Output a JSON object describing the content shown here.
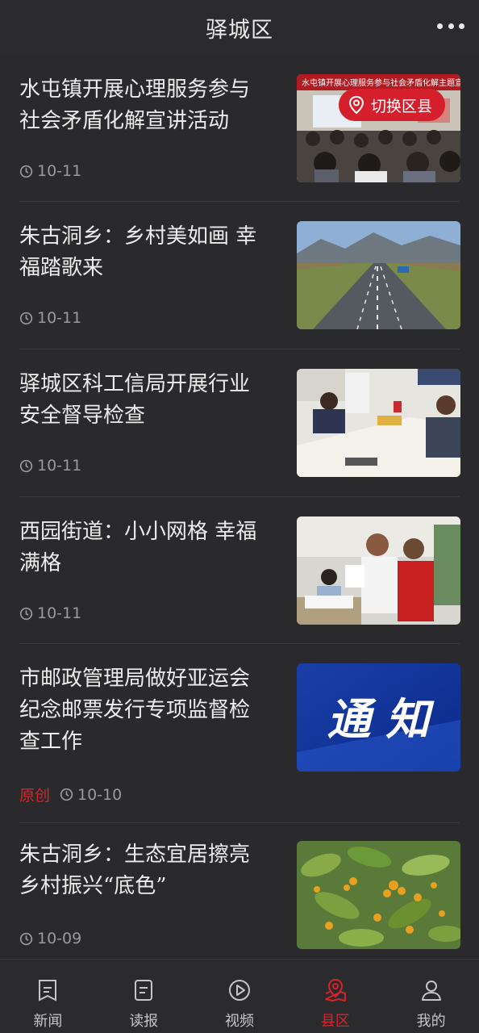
{
  "header": {
    "title": "驿城区",
    "more_icon": "more-dots-icon"
  },
  "switch_button": {
    "label": "切换区县",
    "icon": "location-pin-icon"
  },
  "articles": [
    {
      "title_lines": [
        "水屯镇开展心理服务参与",
        "社会矛盾化解宣讲活动"
      ],
      "original": "",
      "date": "10-11",
      "thumb": "meeting-hall-photo",
      "thumb_caption": "水屯镇开展心理服务参与社会矛盾化解主题宣讲"
    },
    {
      "title_lines": [
        "朱古洞乡：乡村美如画 幸",
        "福踏歌来"
      ],
      "original": "",
      "date": "10-11",
      "thumb": "road-mountains-photo"
    },
    {
      "title_lines": [
        "驿城区科工信局开展行业",
        "安全督导检查"
      ],
      "original": "",
      "date": "10-11",
      "thumb": "office-inspection-photo"
    },
    {
      "title_lines": [
        "西园街道：小小网格 幸福",
        "满格"
      ],
      "original": "",
      "date": "10-11",
      "thumb": "grid-workers-photo"
    },
    {
      "title_lines": [
        "市邮政管理局做好亚运会",
        "纪念邮票发行专项监督检",
        "查工作"
      ],
      "original": "原创",
      "date": "10-10",
      "thumb": "notice-banner",
      "thumb_text": "通 知"
    },
    {
      "title_lines": [
        "朱古洞乡：生态宜居擦亮",
        "乡村振兴“底色”"
      ],
      "original": "",
      "date": "10-09",
      "thumb": "osmanthus-photo"
    }
  ],
  "tabbar": [
    {
      "label": "新闻",
      "icon": "news-icon",
      "active": false
    },
    {
      "label": "读报",
      "icon": "newspaper-icon",
      "active": false
    },
    {
      "label": "视频",
      "icon": "video-play-icon",
      "active": false
    },
    {
      "label": "县区",
      "icon": "map-location-icon",
      "active": true
    },
    {
      "label": "我的",
      "icon": "user-profile-icon",
      "active": false
    }
  ],
  "colors": {
    "background": "#2a2a2c",
    "accent": "#d51f2c",
    "text": "#ececec",
    "muted": "#9a9a9a"
  }
}
